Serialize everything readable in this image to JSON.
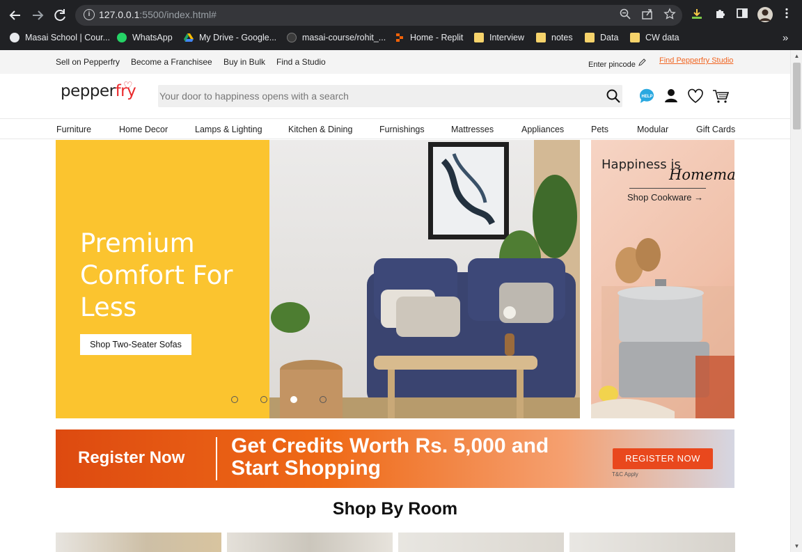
{
  "browser": {
    "url_host": "127.0.0.1",
    "url_rest": ":5500/index.html#",
    "bookmarks": [
      {
        "label": "Masai School | Cour...",
        "icon": "globe-icon"
      },
      {
        "label": "WhatsApp",
        "icon": "whatsapp-icon"
      },
      {
        "label": "My Drive - Google...",
        "icon": "google-drive-icon"
      },
      {
        "label": "masai-course/rohit_...",
        "icon": "github-icon"
      },
      {
        "label": "Home - Replit",
        "icon": "replit-icon"
      },
      {
        "label": "Interview",
        "icon": "folder-icon"
      },
      {
        "label": "notes",
        "icon": "folder-icon"
      },
      {
        "label": "Data",
        "icon": "folder-icon"
      },
      {
        "label": "CW data",
        "icon": "folder-icon"
      }
    ],
    "more": "»"
  },
  "topbar": {
    "sell": "Sell on Pepperfry",
    "franchise": "Become a Franchisee",
    "bulk": "Buy in Bulk",
    "studio": "Find a Studio",
    "pincode": "Enter pincode",
    "find_studio": "Find Pepperfry Studio"
  },
  "header": {
    "logo_a": "pepper",
    "logo_b": "fry",
    "search_placeholder": "Your door to happiness opens with a search",
    "help": "HELP"
  },
  "categories": [
    "Furniture",
    "Home Decor",
    "Lamps & Lighting",
    "Kitchen & Dining",
    "Furnishings",
    "Mattresses",
    "Appliances",
    "Pets",
    "Modular",
    "Gift Cards"
  ],
  "hero": {
    "headline": "Premium Comfort For Less",
    "cta": "Shop Two-Seater Sofas",
    "slides": 4,
    "active_slide": 3
  },
  "side_banner": {
    "line1": "Happiness is",
    "line2": "Homemade",
    "cta": "Shop Cookware →"
  },
  "promo": {
    "register": "Register Now",
    "headline": "Get Credits Worth Rs. 5,000 and Start Shopping",
    "button": "REGISTER NOW",
    "tc": "T&C Apply"
  },
  "section_title": "Shop By Room"
}
